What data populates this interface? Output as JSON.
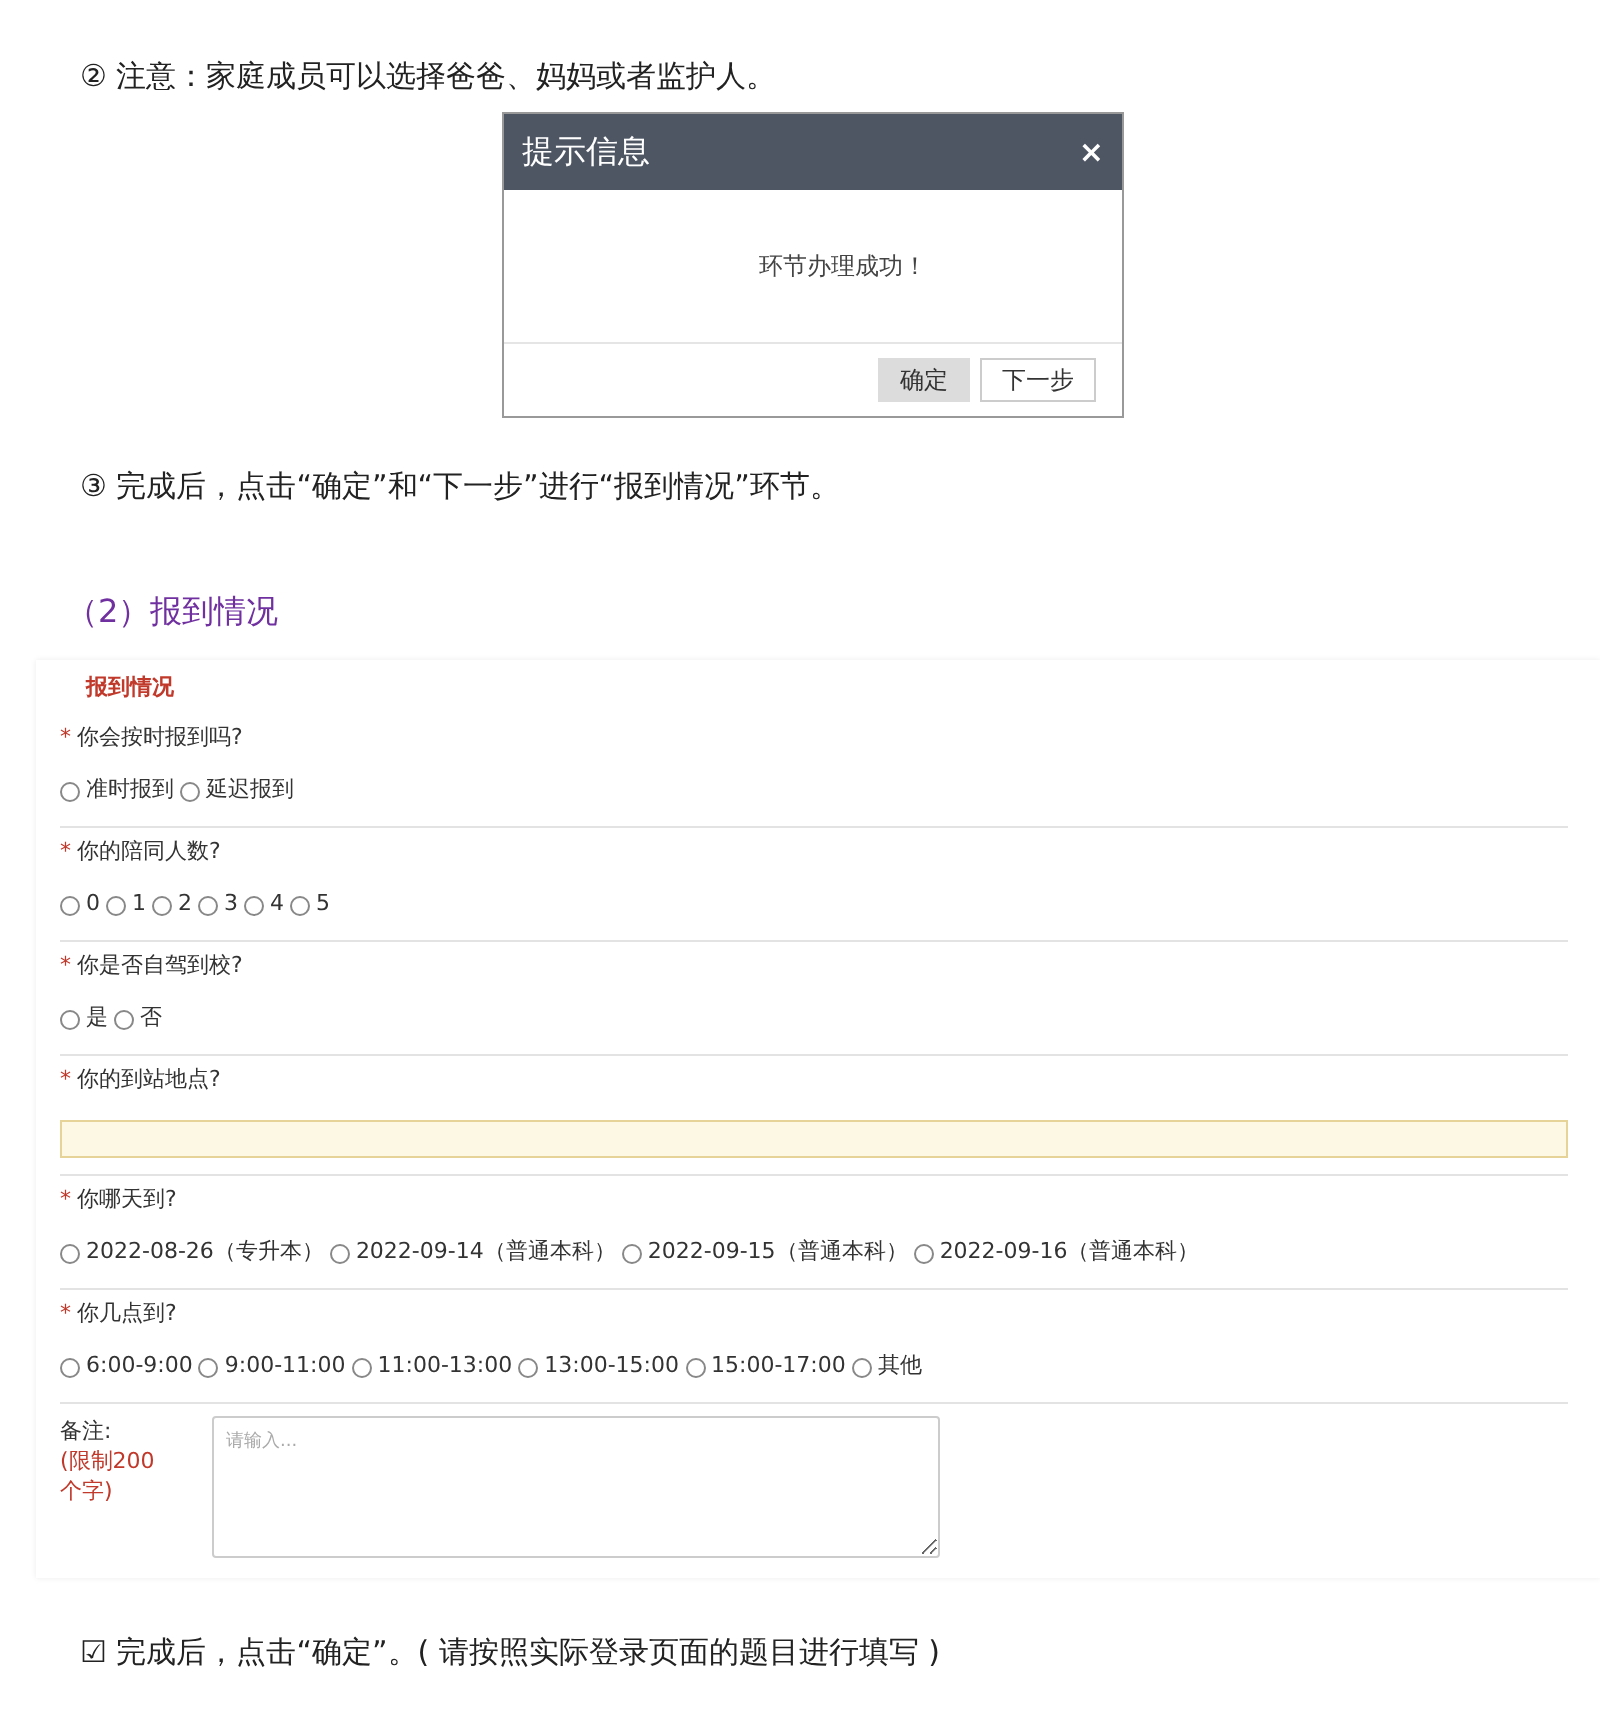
{
  "note_step2": "② 注意：家庭成员可以选择爸爸、妈妈或者监护人。",
  "dialog": {
    "title": "提示信息",
    "close": "×",
    "message": "环节办理成功！",
    "buttons": [
      {
        "label": "确定",
        "selected": true
      },
      {
        "label": "下一步",
        "selected": false
      }
    ]
  },
  "note_step3": "③ 完成后，点击“确定”和“下一步”进行“报到情况”环节。",
  "section_heading": "（2）报到情况",
  "form": {
    "title": "报到情况",
    "questions": [
      {
        "kind": "radio",
        "required": "*",
        "label": "你会按时报到吗?",
        "options": [
          {
            "label": "准时报到",
            "selected": false
          },
          {
            "label": "延迟报到",
            "selected": false
          }
        ]
      },
      {
        "kind": "radio",
        "required": "*",
        "label": "你的陪同人数?",
        "options": [
          {
            "label": "0",
            "selected": false
          },
          {
            "label": "1",
            "selected": false
          },
          {
            "label": "2",
            "selected": false
          },
          {
            "label": "3",
            "selected": false
          },
          {
            "label": "4",
            "selected": false
          },
          {
            "label": "5",
            "selected": false
          }
        ]
      },
      {
        "kind": "radio",
        "required": "*",
        "label": "你是否自驾到校?",
        "options": [
          {
            "label": "是",
            "selected": false
          },
          {
            "label": "否",
            "selected": false
          }
        ]
      },
      {
        "kind": "text",
        "required": "*",
        "label": "你的到站地点?"
      },
      {
        "kind": "radio",
        "required": "*",
        "label": "你哪天到?",
        "options": [
          {
            "label": "2022-08-26（专升本）",
            "selected": false
          },
          {
            "label": "2022-09-14（普通本科）",
            "selected": false
          },
          {
            "label": "2022-09-15（普通本科）",
            "selected": false
          },
          {
            "label": "2022-09-16（普通本科）",
            "selected": false
          }
        ]
      },
      {
        "kind": "radio",
        "required": "*",
        "label": "你几点到?",
        "options": [
          {
            "label": "6:00-9:00",
            "selected": false
          },
          {
            "label": "9:00-11:00",
            "selected": false
          },
          {
            "label": "11:00-13:00",
            "selected": false
          },
          {
            "label": "13:00-15:00",
            "selected": false
          },
          {
            "label": "15:00-17:00",
            "selected": false
          },
          {
            "label": "其他",
            "selected": false
          }
        ]
      }
    ],
    "remark": {
      "label": "备注:",
      "limit": "(限制200个字)",
      "placeholder": "请输入..."
    }
  },
  "final_note": "☑ 完成后，点击“确定”。( 请按照实际登录页面的题目进行填写 )"
}
